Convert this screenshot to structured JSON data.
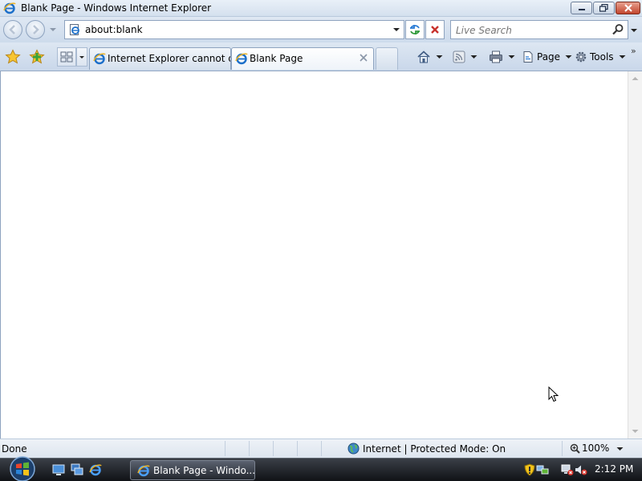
{
  "window": {
    "title": "Blank Page - Windows Internet Explorer",
    "icon": "ie-icon",
    "controls": [
      "minimize-icon",
      "maximize-icon",
      "close-icon"
    ]
  },
  "address_bar": {
    "url": "about:blank",
    "search_placeholder": "Live Search"
  },
  "tabs": [
    {
      "label": "Internet Explorer cannot di...",
      "active": false
    },
    {
      "label": "Blank Page",
      "active": true
    }
  ],
  "command_bar": {
    "page_label": "Page",
    "tools_label": "Tools"
  },
  "status_bar": {
    "status": "Done",
    "zone": "Internet | Protected Mode: On",
    "zoom": "100%"
  },
  "taskbar": {
    "task_label": "Blank Page - Windo...",
    "clock": "2:12 PM"
  },
  "colors": {
    "chrome_bg": "#dfe8f3",
    "taskbar_bg": "#1a1d22",
    "close_red": "#c2452d",
    "ie_blue": "#1c6fc9"
  }
}
